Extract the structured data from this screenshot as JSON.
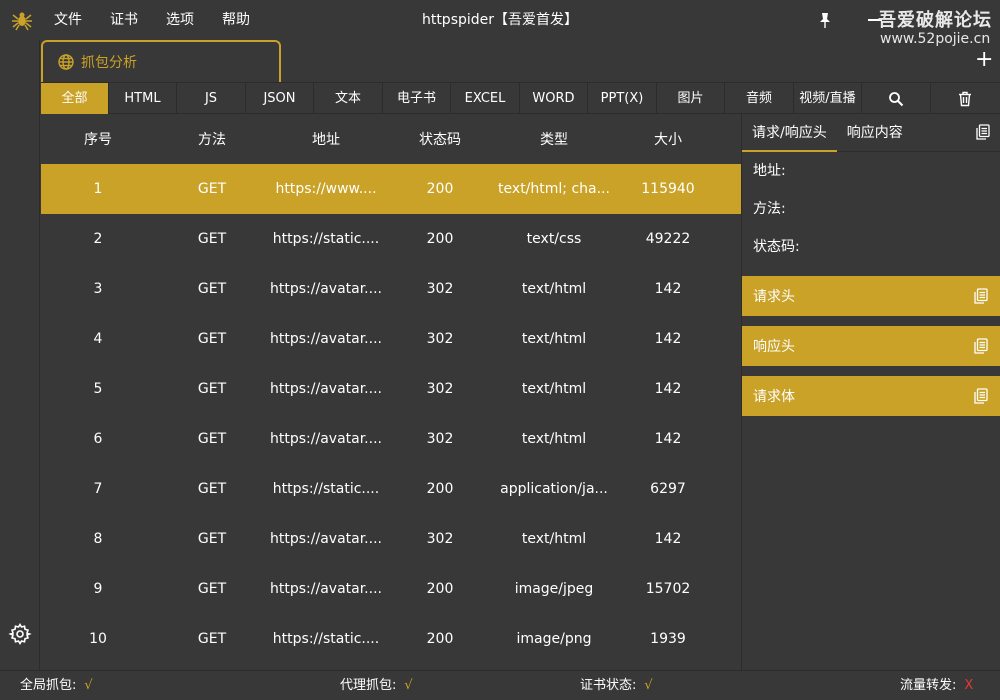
{
  "window": {
    "title": "httpspider【吾爱首发】",
    "menu": [
      "文件",
      "证书",
      "选项",
      "帮助"
    ],
    "watermark_line1": "吾爱破解论坛",
    "watermark_line2": "www.52pojie.cn"
  },
  "tab": {
    "label": "抓包分析",
    "add_label": "+"
  },
  "filters": [
    "全部",
    "HTML",
    "JS",
    "JSON",
    "文本",
    "电子书",
    "EXCEL",
    "WORD",
    "PPT(X)",
    "图片",
    "音频",
    "视频/直播"
  ],
  "table": {
    "headers": [
      "序号",
      "方法",
      "地址",
      "状态码",
      "类型",
      "大小"
    ],
    "rows": [
      [
        "1",
        "GET",
        "https://www....",
        "200",
        "text/html; cha...",
        "115940"
      ],
      [
        "2",
        "GET",
        "https://static....",
        "200",
        "text/css",
        "49222"
      ],
      [
        "3",
        "GET",
        "https://avatar....",
        "302",
        "text/html",
        "142"
      ],
      [
        "4",
        "GET",
        "https://avatar....",
        "302",
        "text/html",
        "142"
      ],
      [
        "5",
        "GET",
        "https://avatar....",
        "302",
        "text/html",
        "142"
      ],
      [
        "6",
        "GET",
        "https://avatar....",
        "302",
        "text/html",
        "142"
      ],
      [
        "7",
        "GET",
        "https://static....",
        "200",
        "application/ja...",
        "6297"
      ],
      [
        "8",
        "GET",
        "https://avatar....",
        "302",
        "text/html",
        "142"
      ],
      [
        "9",
        "GET",
        "https://avatar....",
        "200",
        "image/jpeg",
        "15702"
      ],
      [
        "10",
        "GET",
        "https://static....",
        "200",
        "image/png",
        "1939"
      ]
    ]
  },
  "detail": {
    "tabs": [
      "请求/响应头",
      "响应内容"
    ],
    "fields": [
      "地址:",
      "方法:",
      "状态码:"
    ],
    "sections": [
      "请求头",
      "响应头",
      "请求体"
    ]
  },
  "statusbar": {
    "global_capture": "全局抓包:",
    "global_capture_value": "√",
    "proxy_capture": "代理抓包:",
    "proxy_capture_value": "√",
    "cert_status": "证书状态:",
    "cert_status_value": "√",
    "forwarding": "流量转发:",
    "forwarding_value": "X"
  },
  "colors": {
    "accent": "#c9a227",
    "background": "#383838",
    "error": "#e53935"
  },
  "icons": [
    "spider-icon",
    "pin-icon",
    "minimize-icon",
    "globe-icon",
    "plus-icon",
    "search-icon",
    "trash-icon",
    "copy-icon",
    "gear-icon"
  ]
}
